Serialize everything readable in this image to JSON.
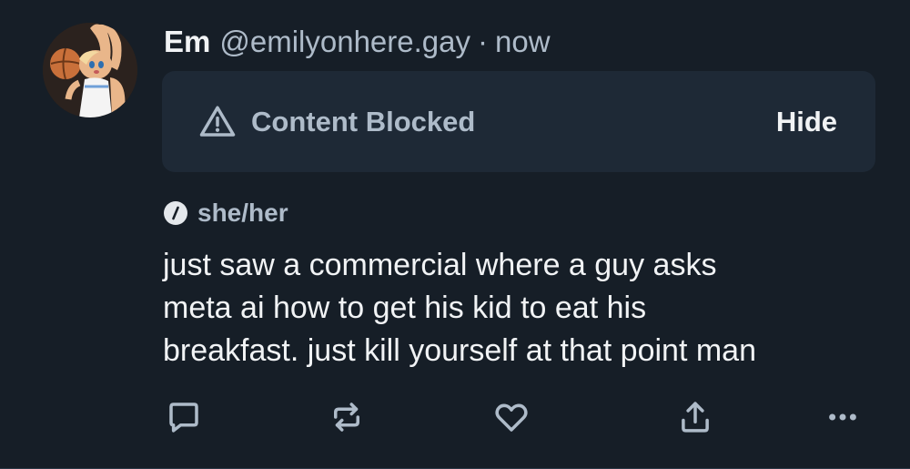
{
  "post": {
    "display_name": "Em",
    "handle": "@emilyonhere.gay",
    "separator": "·",
    "timestamp": "now",
    "avatar_icon": "cartoon-bunny-basketball-avatar",
    "content_warning": {
      "label": "Content Blocked",
      "icon": "warning-triangle-icon",
      "action_label": "Hide"
    },
    "pronouns": "she/her",
    "text_lines": [
      "just saw a commercial where a guy asks",
      "meta ai how to get his kid to eat his",
      "breakfast. just kill yourself at that point man"
    ],
    "actions": [
      {
        "name": "reply",
        "icon": "reply-icon"
      },
      {
        "name": "repost",
        "icon": "repost-icon"
      },
      {
        "name": "like",
        "icon": "heart-icon"
      },
      {
        "name": "share",
        "icon": "share-icon"
      },
      {
        "name": "more",
        "icon": "more-options-icon"
      }
    ]
  },
  "colors": {
    "background": "#161e27",
    "panel": "#1e2936",
    "primary_text": "#f1f3f5",
    "secondary_text": "#aebbc9",
    "icon": "#aebbc9"
  }
}
